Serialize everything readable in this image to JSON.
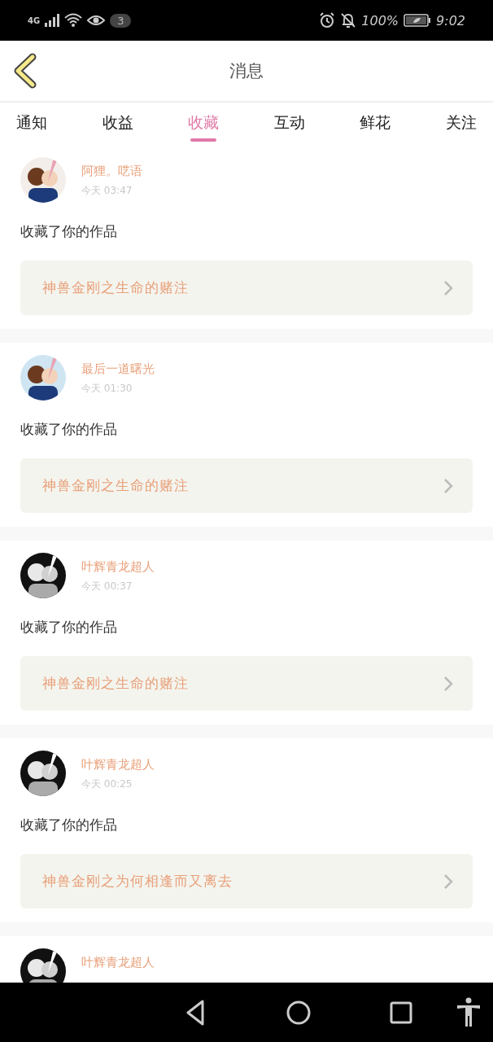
{
  "status_bar": {
    "network": "4G",
    "notification_count": "3",
    "battery": "100%",
    "time": "9:02"
  },
  "header": {
    "title": "消息"
  },
  "tabs": [
    {
      "label": "通知",
      "selected": false
    },
    {
      "label": "收益",
      "selected": false
    },
    {
      "label": "收藏",
      "selected": true
    },
    {
      "label": "互动",
      "selected": false
    },
    {
      "label": "鲜花",
      "selected": false
    },
    {
      "label": "关注",
      "selected": false
    }
  ],
  "messages": [
    {
      "name": "阿狸。呓语",
      "time": "今天  03:47",
      "action": "收藏了你的作品",
      "work": "神兽金刚之生命的赌注"
    },
    {
      "name": "最后一道曙光",
      "time": "今天  01:30",
      "action": "收藏了你的作品",
      "work": "神兽金刚之生命的赌注"
    },
    {
      "name": "叶辉青龙超人",
      "time": "今天  00:37",
      "action": "收藏了你的作品",
      "work": "神兽金刚之生命的赌注"
    },
    {
      "name": "叶辉青龙超人",
      "time": "今天  00:25",
      "action": "收藏了你的作品",
      "work": "神兽金刚之为何相逢而又离去"
    },
    {
      "name": "叶辉青龙超人"
    }
  ]
}
